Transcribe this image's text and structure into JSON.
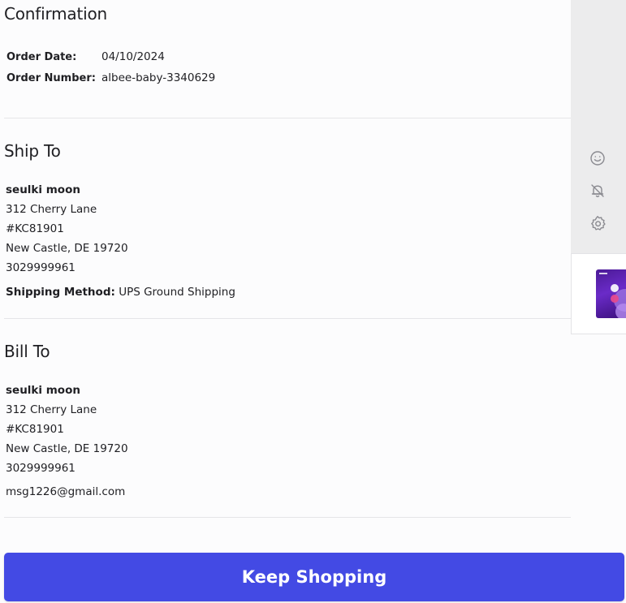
{
  "confirmation": {
    "title": "Confirmation",
    "order_date_label": "Order Date:",
    "order_date_value": "04/10/2024",
    "order_number_label": "Order Number:",
    "order_number_value": "albee-baby-3340629"
  },
  "ship_to": {
    "title": "Ship To",
    "name": "seulki moon",
    "address1": "312 Cherry Lane",
    "address2": "#KC81901",
    "city_state_zip": "New Castle, DE 19720",
    "phone": "3029999961",
    "shipping_method_label": "Shipping Method:",
    "shipping_method_value": "UPS Ground Shipping"
  },
  "bill_to": {
    "title": "Bill To",
    "name": "seulki moon",
    "address1": "312 Cherry Lane",
    "address2": "#KC81901",
    "city_state_zip": "New Castle, DE 19720",
    "phone": "3029999961",
    "email": "msg1226@gmail.com"
  },
  "actions": {
    "keep_shopping_label": "Keep Shopping"
  },
  "side_panel": {
    "icons": [
      "smiley-icon",
      "bell-off-icon",
      "gear-icon"
    ],
    "thumbnail_icon": "product-thumbnail"
  },
  "colors": {
    "accent": "#434ae4",
    "side_panel_bg": "#ececed",
    "divider": "#e5e5e8",
    "text": "#1f1f23"
  }
}
